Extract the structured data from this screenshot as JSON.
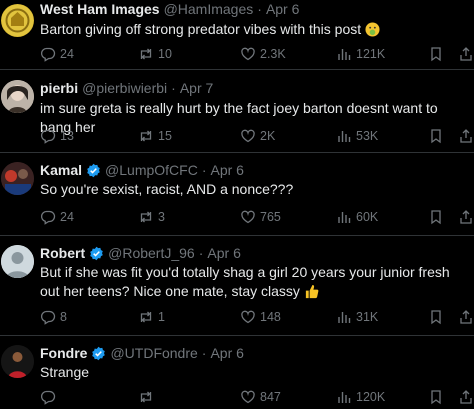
{
  "tweets": [
    {
      "name": "West Ham Images",
      "handle": "@HamImages",
      "time": "Apr 6",
      "verified": false,
      "text": "Barton giving off strong predator vibes with this post",
      "emoji": "nauseated-face",
      "replies": "24",
      "reposts": "10",
      "likes": "2.3K",
      "views": "121K"
    },
    {
      "name": "pierbi",
      "handle": "@pierbiwierbi",
      "time": "Apr 7",
      "verified": false,
      "text": "im sure greta is really hurt by the fact joey barton doesnt want to bang her",
      "replies": "13",
      "reposts": "15",
      "likes": "2K",
      "views": "53K"
    },
    {
      "name": "Kamal",
      "handle": "@LumpOfCFC",
      "time": "Apr 6",
      "verified": true,
      "text": "So you're sexist, racist, AND a nonce???",
      "replies": "24",
      "reposts": "3",
      "likes": "765",
      "views": "60K"
    },
    {
      "name": "Robert",
      "handle": "@RobertJ_96",
      "time": "Apr 6",
      "verified": true,
      "text": "But if she was fit you'd totally shag a girl 20 years your junior fresh out her teens? Nice one mate, stay classy",
      "emoji": "thumbs-up",
      "replies": "8",
      "reposts": "1",
      "likes": "148",
      "views": "31K"
    },
    {
      "name": "Fondre",
      "handle": "@UTDFondre",
      "time": "Apr 6",
      "verified": true,
      "text": "Strange",
      "replies": "",
      "reposts": "",
      "likes": "847",
      "views": "120K"
    }
  ],
  "sep": "·",
  "colors": {
    "background": "#000000",
    "text": "#e7e9ea",
    "muted": "#71767b",
    "verified": "#1d9bf0",
    "border": "#2f3336"
  },
  "icons": [
    "reply-icon",
    "repost-icon",
    "like-icon",
    "views-icon",
    "bookmark-icon",
    "share-icon",
    "verified-badge-icon"
  ]
}
